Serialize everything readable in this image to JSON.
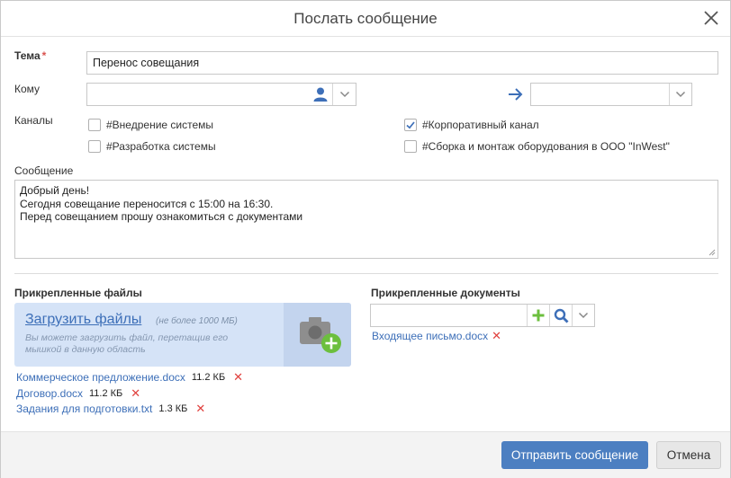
{
  "dialog": {
    "title": "Послать сообщение"
  },
  "subject": {
    "label": "Тема",
    "required_mark": "*",
    "value": "Перенос совещания"
  },
  "to": {
    "label": "Кому",
    "value": "",
    "target_value": ""
  },
  "channels": {
    "label": "Каналы",
    "items": [
      {
        "label": "#Внедрение системы",
        "checked": false
      },
      {
        "label": "#Корпоративный канал",
        "checked": true
      },
      {
        "label": "#Разработка системы",
        "checked": false
      },
      {
        "label": "#Сборка и монтаж оборудования в ООО \"InWest\"",
        "checked": false
      }
    ]
  },
  "message": {
    "label": "Сообщение",
    "lines": [
      "Добрый день!",
      "Сегодня совещание переносится с 15:00 на 16:30.",
      "Перед совещанием прошу ознакомиться с документами"
    ]
  },
  "attached_files": {
    "heading": "Прикрепленные файлы",
    "upload_link": "Загрузить файлы",
    "upload_limit": "(не более 1000 МБ)",
    "upload_hint": "Вы можете загрузить файл, перетащив его мышкой в данную область",
    "files": [
      {
        "name": "Коммерческое предложение.docx",
        "size": "11.2 КБ"
      },
      {
        "name": "Договор.docx",
        "size": "11.2 КБ"
      },
      {
        "name": "Задания для подготовки.txt",
        "size": "1.3 КБ"
      }
    ],
    "delete_glyph": "✕"
  },
  "attached_documents": {
    "heading": "Прикрепленные документы",
    "search_value": "",
    "documents": [
      {
        "name": "Входящее письмо.docx"
      }
    ]
  },
  "footer": {
    "send_label": "Отправить сообщение",
    "cancel_label": "Отмена"
  },
  "colors": {
    "accent": "#4c7fc1",
    "link": "#3d6fb8",
    "danger": "#e0403d",
    "add_green": "#6cbf3e"
  },
  "icons": [
    "close-icon",
    "user-icon",
    "chevron-down-icon",
    "arrow-right-icon",
    "checkmark-icon",
    "camera-add-icon",
    "plus-icon",
    "search-icon",
    "delete-x-icon"
  ]
}
